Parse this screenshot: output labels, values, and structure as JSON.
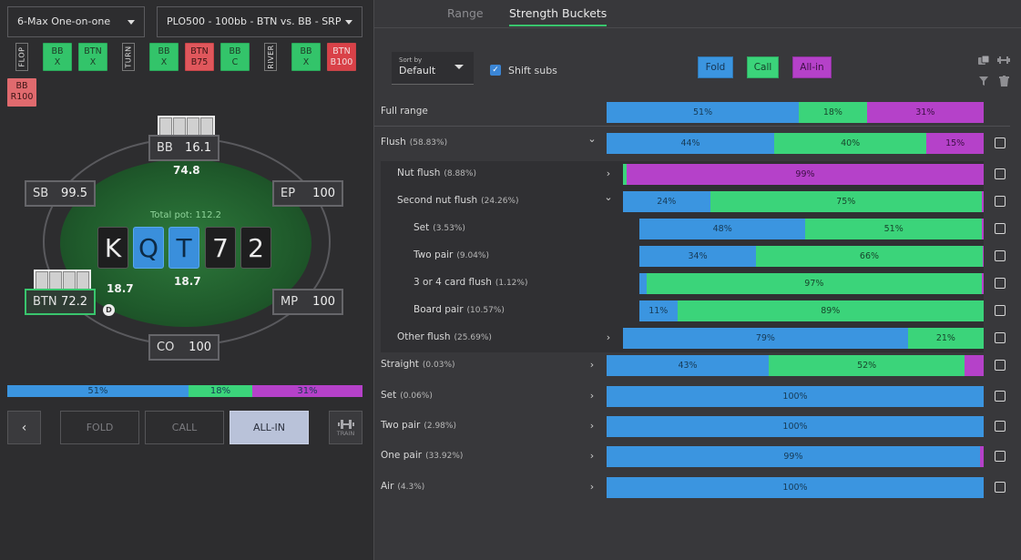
{
  "colors": {
    "fold": "#3b95e0",
    "call": "#3bd47a",
    "allin": "#b541c9",
    "accent": "#39c56d"
  },
  "header": {
    "game_select": "6-Max One-on-one",
    "spot_select": "PLO500 - 100bb - BTN vs. BB - SRP"
  },
  "action_line": {
    "flop_label": "FLOP",
    "turn_label": "TURN",
    "river_label": "RIVER",
    "actions": [
      {
        "line1": "BB",
        "line2": "X"
      },
      {
        "line1": "BTN",
        "line2": "X"
      },
      {
        "line1": "BB",
        "line2": "X"
      },
      {
        "line1": "BTN",
        "line2": "B75"
      },
      {
        "line1": "BB",
        "line2": "C"
      },
      {
        "line1": "BB",
        "line2": "X"
      },
      {
        "line1": "BTN",
        "line2": "B100"
      },
      {
        "line1": "BB",
        "line2": "R100"
      }
    ]
  },
  "table": {
    "seats": [
      {
        "pos": "BB",
        "stack": "16.1"
      },
      {
        "pos": "SB",
        "stack": "99.5"
      },
      {
        "pos": "EP",
        "stack": "100"
      },
      {
        "pos": "BTN",
        "stack": "72.2"
      },
      {
        "pos": "MP",
        "stack": "100"
      },
      {
        "pos": "CO",
        "stack": "100"
      }
    ],
    "bb_bet": "74.8",
    "btn_bet": "18.7",
    "btn_bet2": "18.7",
    "pot_label": "Total pot: 112.2",
    "dealer": "D",
    "board": [
      "K",
      "Q",
      "T",
      "7",
      "2"
    ]
  },
  "left_freq": {
    "fold": "51%",
    "call": "18%",
    "allin": "31%",
    "fold_v": 51,
    "call_v": 18,
    "allin_v": 31
  },
  "buttons": {
    "back": "‹",
    "fold": "FOLD",
    "call": "CALL",
    "allin": "ALL-IN",
    "train": "TRAIN"
  },
  "tabs": {
    "range": "Range",
    "strength": "Strength Buckets"
  },
  "controls": {
    "sort_by_label": "Sort by",
    "sort_by_value": "Default",
    "shift_subs": "Shift subs",
    "legend": {
      "fold": "Fold",
      "call": "Call",
      "allin": "All-in"
    }
  },
  "rows": [
    {
      "label": "Full range",
      "pct": "",
      "fold": 51,
      "call": 18,
      "allin": 31,
      "t_fold": "51%",
      "t_call": "18%",
      "t_allin": "31%"
    },
    {
      "label": "Flush",
      "pct": "(58.83%)",
      "fold": 44,
      "call": 40,
      "allin": 15,
      "t_fold": "44%",
      "t_call": "40%",
      "t_allin": "15%"
    },
    {
      "label": "Nut flush",
      "pct": "(8.88%)",
      "fold": 0,
      "call": 1,
      "allin": 99,
      "t_fold": "",
      "t_call": "",
      "t_allin": "99%"
    },
    {
      "label": "Second nut flush",
      "pct": "(24.26%)",
      "fold": 24,
      "call": 75,
      "allin": 0.5,
      "t_fold": "24%",
      "t_call": "75%",
      "t_allin": ""
    },
    {
      "label": "Set",
      "pct": "(3.53%)",
      "fold": 48,
      "call": 51,
      "allin": 0.5,
      "t_fold": "48%",
      "t_call": "51%",
      "t_allin": ""
    },
    {
      "label": "Two pair",
      "pct": "(9.04%)",
      "fold": 34,
      "call": 66,
      "allin": 0.3,
      "t_fold": "34%",
      "t_call": "66%",
      "t_allin": ""
    },
    {
      "label": "3 or 4 card flush",
      "pct": "(1.12%)",
      "fold": 2,
      "call": 97,
      "allin": 0.5,
      "t_fold": "",
      "t_call": "97%",
      "t_allin": ""
    },
    {
      "label": "Board pair",
      "pct": "(10.57%)",
      "fold": 11,
      "call": 89,
      "allin": 0,
      "t_fold": "11%",
      "t_call": "89%",
      "t_allin": ""
    },
    {
      "label": "Other flush",
      "pct": "(25.69%)",
      "fold": 79,
      "call": 21,
      "allin": 0,
      "t_fold": "79%",
      "t_call": "21%",
      "t_allin": ""
    },
    {
      "label": "Straight",
      "pct": "(0.03%)",
      "fold": 43,
      "call": 52,
      "allin": 5,
      "t_fold": "43%",
      "t_call": "52%",
      "t_allin": ""
    },
    {
      "label": "Set",
      "pct": "(0.06%)",
      "fold": 100,
      "call": 0,
      "allin": 0,
      "t_fold": "100%",
      "t_call": "",
      "t_allin": ""
    },
    {
      "label": "Two pair",
      "pct": "(2.98%)",
      "fold": 100,
      "call": 0,
      "allin": 0,
      "t_fold": "100%",
      "t_call": "",
      "t_allin": ""
    },
    {
      "label": "One pair",
      "pct": "(33.92%)",
      "fold": 99,
      "call": 0,
      "allin": 1,
      "t_fold": "99%",
      "t_call": "",
      "t_allin": ""
    },
    {
      "label": "Air",
      "pct": "(4.3%)",
      "fold": 100,
      "call": 0,
      "allin": 0,
      "t_fold": "100%",
      "t_call": "",
      "t_allin": ""
    }
  ]
}
